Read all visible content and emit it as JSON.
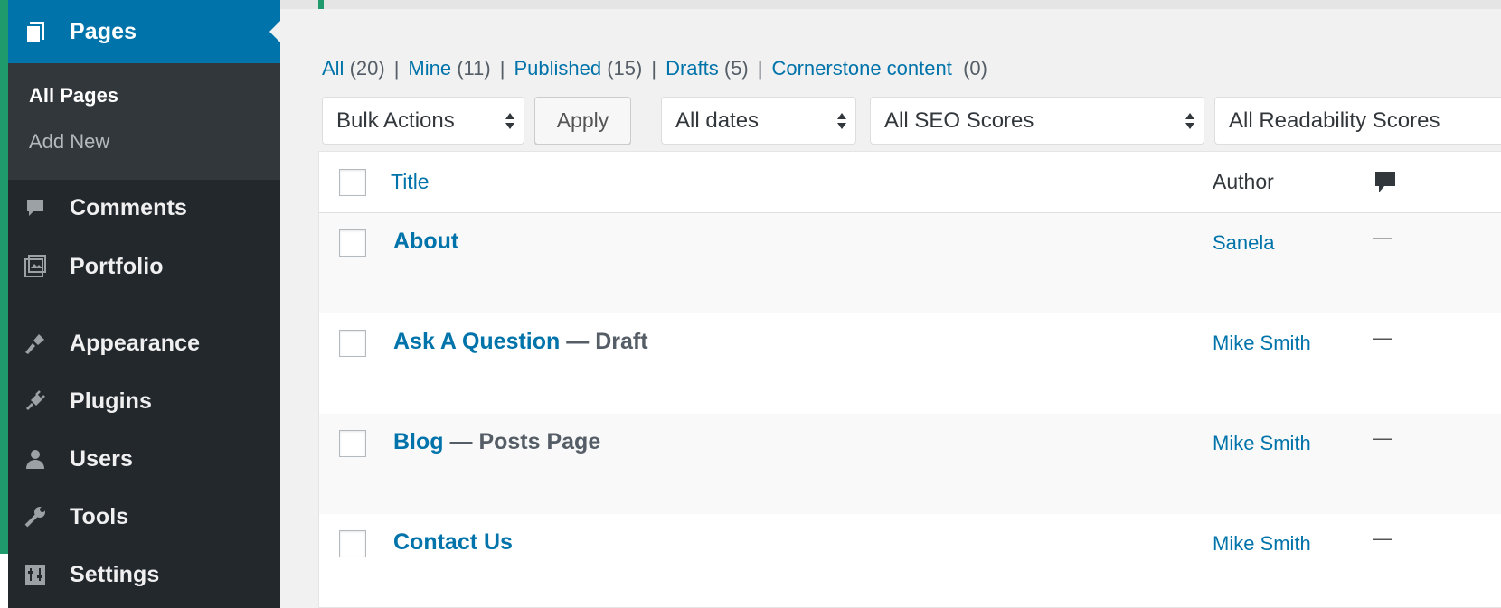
{
  "sidebar": {
    "active_menu": {
      "label": "Pages",
      "icon": "pages-icon"
    },
    "submenu": [
      {
        "label": "All Pages",
        "current": true
      },
      {
        "label": "Add New",
        "current": false
      }
    ],
    "items": [
      {
        "label": "Comments",
        "icon": "comments-icon"
      },
      {
        "label": "Portfolio",
        "icon": "portfolio-icon"
      },
      {
        "label": "Appearance",
        "icon": "appearance-icon"
      },
      {
        "label": "Plugins",
        "icon": "plugins-icon"
      },
      {
        "label": "Users",
        "icon": "users-icon"
      },
      {
        "label": "Tools",
        "icon": "tools-icon"
      },
      {
        "label": "Settings",
        "icon": "settings-icon"
      }
    ]
  },
  "filters": {
    "all": {
      "label": "All",
      "count": "(20)"
    },
    "mine": {
      "label": "Mine",
      "count": "(11)"
    },
    "published": {
      "label": "Published",
      "count": "(15)"
    },
    "drafts": {
      "label": "Drafts",
      "count": "(5)"
    },
    "cornerstone": {
      "label": "Cornerstone content",
      "count": "(0)"
    },
    "separator": "|"
  },
  "toolbar": {
    "bulk_actions": "Bulk Actions",
    "apply": "Apply",
    "dates": "All dates",
    "seo": "All SEO Scores",
    "readability": "All Readability Scores"
  },
  "table": {
    "headers": {
      "title": "Title",
      "author": "Author",
      "comments_icon": "comment-bubble-icon"
    },
    "rows": [
      {
        "title": "About",
        "state": "",
        "author": "Sanela",
        "comments": "—"
      },
      {
        "title": "Ask A Question",
        "state": " — Draft",
        "author": "Mike Smith",
        "comments": "—"
      },
      {
        "title": "Blog",
        "state": " — Posts Page",
        "author": "Mike Smith",
        "comments": "—"
      },
      {
        "title": "Contact Us",
        "state": "",
        "author": "Mike Smith",
        "comments": "—"
      }
    ]
  },
  "colors": {
    "frame": "#1e9a6c",
    "sidebar": "#23282d",
    "active": "#0073aa",
    "link": "#0073aa"
  }
}
